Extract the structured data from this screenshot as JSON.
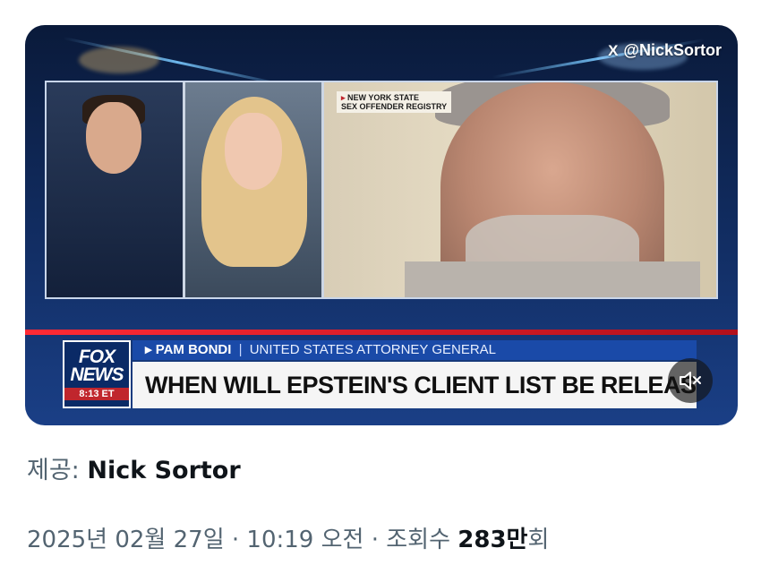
{
  "media": {
    "watermark_handle": "@NickSortor",
    "watermark_x_logo": "X",
    "registry_label_arrow": "▸",
    "registry_label": "NEW YORK STATE\nSEX OFFENDER REGISTRY",
    "fox_logo_line1": "FOX",
    "fox_logo_line2": "NEWS",
    "fox_clock": "8:13 ET",
    "name_arrow": "▸",
    "speaker_name": "PAM BONDI",
    "speaker_separator": "|",
    "speaker_title": "UNITED STATES ATTORNEY GENERAL",
    "headline": "WHEN WILL EPSTEIN'S CLIENT LIST BE RELEASED?",
    "mute_icon": "volume-muted-icon"
  },
  "caption": {
    "prefix": "제공: ",
    "author": "Nick Sortor"
  },
  "meta": {
    "date_time": "2025년 02월 27일 · 10:19 오전 · 조회수 ",
    "views_number": "283만",
    "views_suffix": "회"
  },
  "colors": {
    "fox_blue": "#1a4aa8",
    "fox_red": "#c0262d",
    "muted_text": "#536471",
    "primary_text": "#0f1419"
  }
}
